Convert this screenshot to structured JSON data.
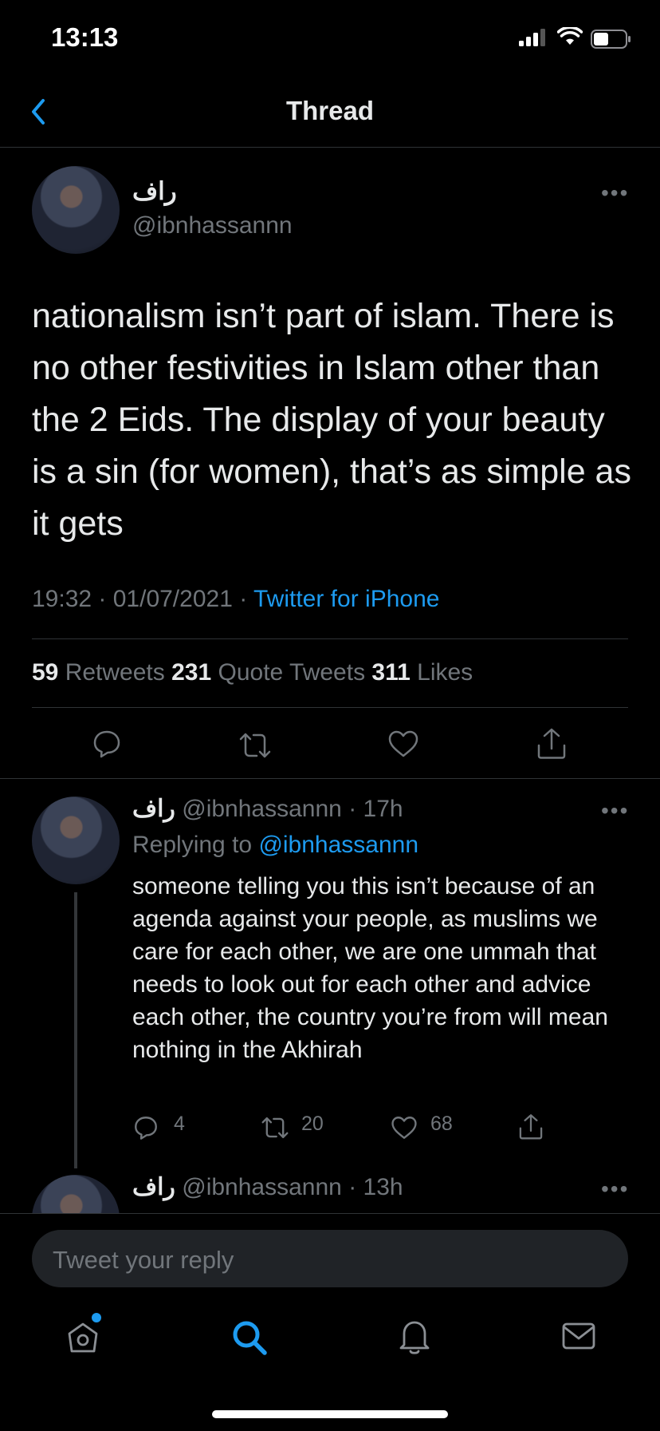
{
  "status_bar": {
    "time": "13:13"
  },
  "header": {
    "title": "Thread"
  },
  "tweet": {
    "author_name": "راف",
    "author_handle": "@ibnhassannn",
    "text": "nationalism isn’t part of islam. There is no other festivities in Islam other than the 2 Eids. The display of your beauty is a sin (for women), that’s as simple as it gets",
    "datetime": "19:32 · 01/07/2021 · ",
    "source": "Twitter for iPhone",
    "stats": {
      "retweets_count": "59",
      "retweets_label": " Retweets  ",
      "quotes_count": "231",
      "quotes_label": " Quote Tweets  ",
      "likes_count": "311",
      "likes_label": " Likes"
    }
  },
  "replies": [
    {
      "author_name": "راف",
      "handle_time": " @ibnhassannn · 17h",
      "replying_prefix": "Replying to ",
      "replying_handle": "@ibnhassannn",
      "text": "someone telling you this isn’t because of an agenda against your people, as muslims we care for each other, we are one ummah that needs to look out for each other and advice each other, the country you’re from will mean nothing in the Akhirah",
      "reply_count": "4",
      "retweet_count": "20",
      "like_count": "68"
    },
    {
      "author_name": "راف",
      "handle_time": " @ibnhassannn · 13h"
    }
  ],
  "composer": {
    "placeholder": "Tweet your reply"
  },
  "colors": {
    "background": "#000000",
    "accent": "#1d9bf0",
    "secondary_text": "#71767b",
    "divider": "#2f3336"
  },
  "icons": [
    "back-chevron-icon",
    "more-icon",
    "reply-icon",
    "retweet-icon",
    "like-icon",
    "share-icon",
    "home-icon",
    "search-icon",
    "notifications-icon",
    "messages-icon"
  ]
}
